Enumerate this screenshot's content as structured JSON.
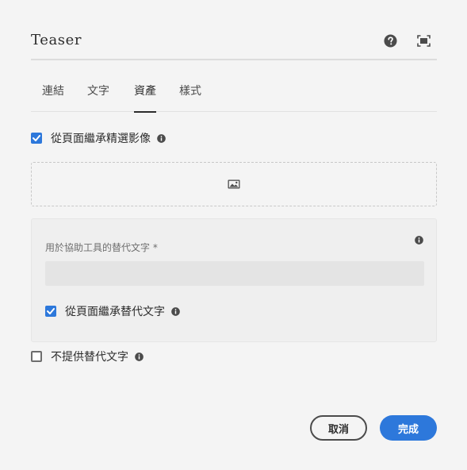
{
  "dialog": {
    "title": "Teaser"
  },
  "tabs": [
    {
      "label": "連結"
    },
    {
      "label": "文字"
    },
    {
      "label": "資產"
    },
    {
      "label": "樣式"
    }
  ],
  "active_tab": "資產",
  "inherit_featured_image": {
    "label": "從頁面繼承精選影像",
    "checked": true
  },
  "alt_text": {
    "label": "用於協助工具的替代文字 *",
    "value": "",
    "inherit": {
      "label": "從頁面繼承替代文字",
      "checked": true
    }
  },
  "no_alt_text": {
    "label": "不提供替代文字",
    "checked": false
  },
  "footer": {
    "cancel_label": "取消",
    "done_label": "完成"
  },
  "colors": {
    "accent": "#2d78db",
    "background": "#f4f4f4"
  }
}
